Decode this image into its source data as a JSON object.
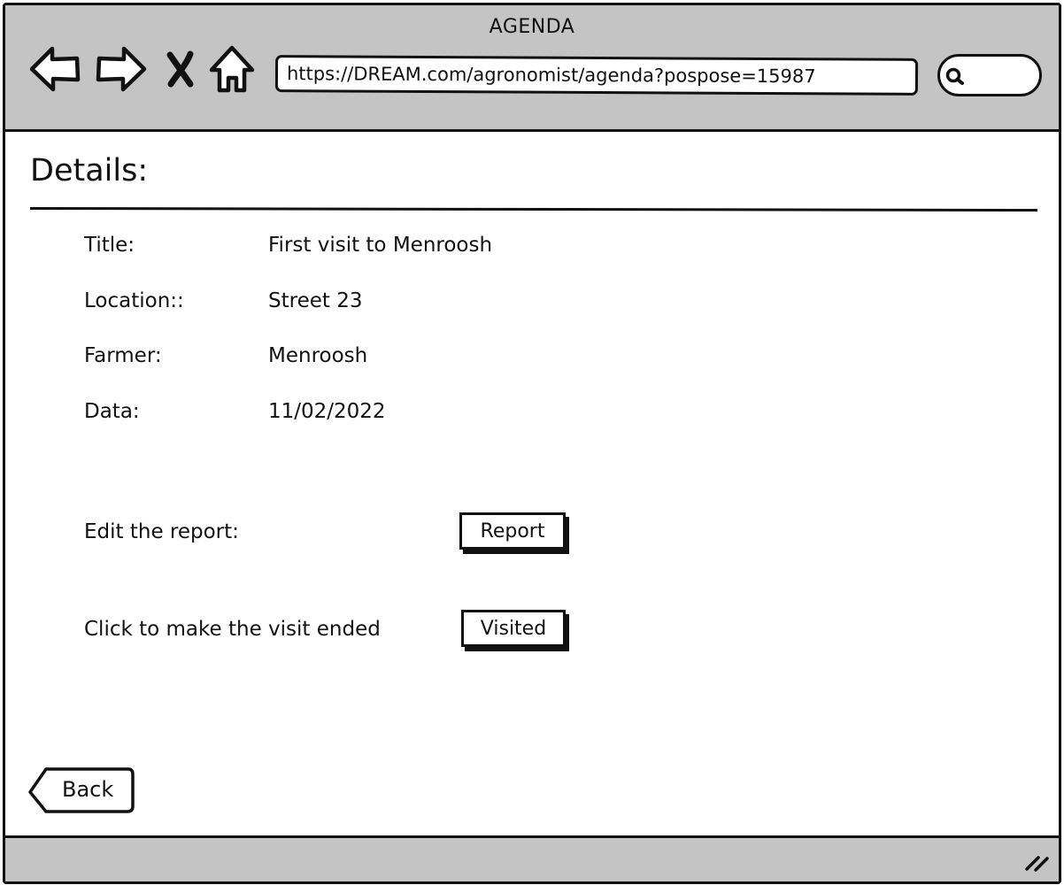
{
  "window": {
    "title": "AGENDA"
  },
  "browser": {
    "url": "https://DREAM.com/agronomist/agenda?pospose=15987",
    "icons": {
      "back": "arrow-left-icon",
      "forward": "arrow-right-icon",
      "stop": "close-icon",
      "home": "home-icon",
      "search": "search-icon"
    }
  },
  "page": {
    "heading": "Details:",
    "details": [
      {
        "label": "Title:",
        "value": "First visit to Menroosh"
      },
      {
        "label": "Location::",
        "value": "Street 23"
      },
      {
        "label": "Farmer:",
        "value": "Menroosh"
      },
      {
        "label": "Data:",
        "value": "11/02/2022"
      }
    ],
    "actions": {
      "report_prompt": "Edit the report:",
      "report_button": "Report",
      "visited_prompt": "Click to make the visit ended",
      "visited_button": "Visited"
    },
    "back_button": "Back"
  },
  "colors": {
    "chrome_gray": "#c4c4c4",
    "ink": "#111111",
    "background": "#ffffff"
  }
}
